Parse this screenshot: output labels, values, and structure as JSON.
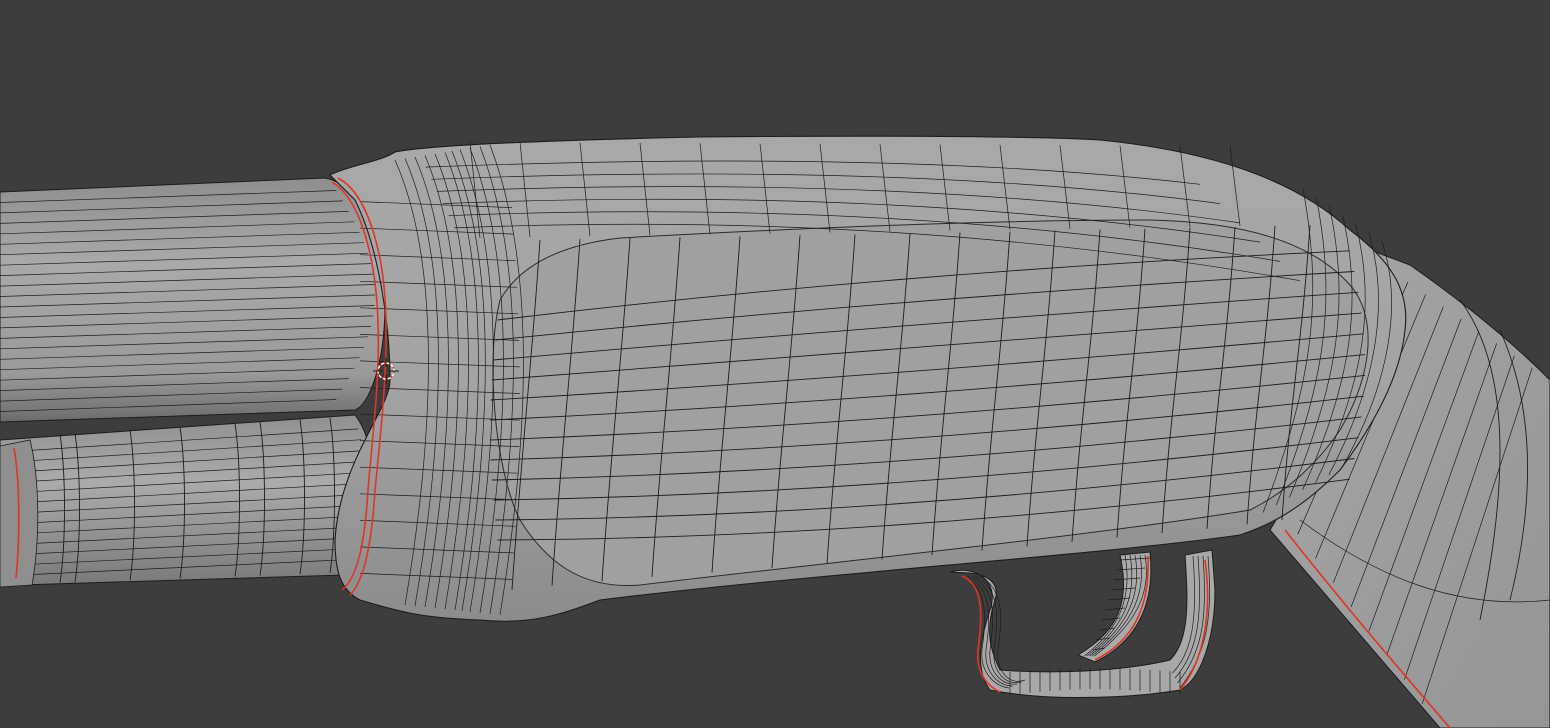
{
  "viewport": {
    "background_color": "#3d3d3d",
    "mesh_color": "#a3a3a3",
    "wire_color": "#1c1c1c",
    "seam_color": "#e0342a",
    "cursor_icon": "3d-cursor-icon"
  }
}
